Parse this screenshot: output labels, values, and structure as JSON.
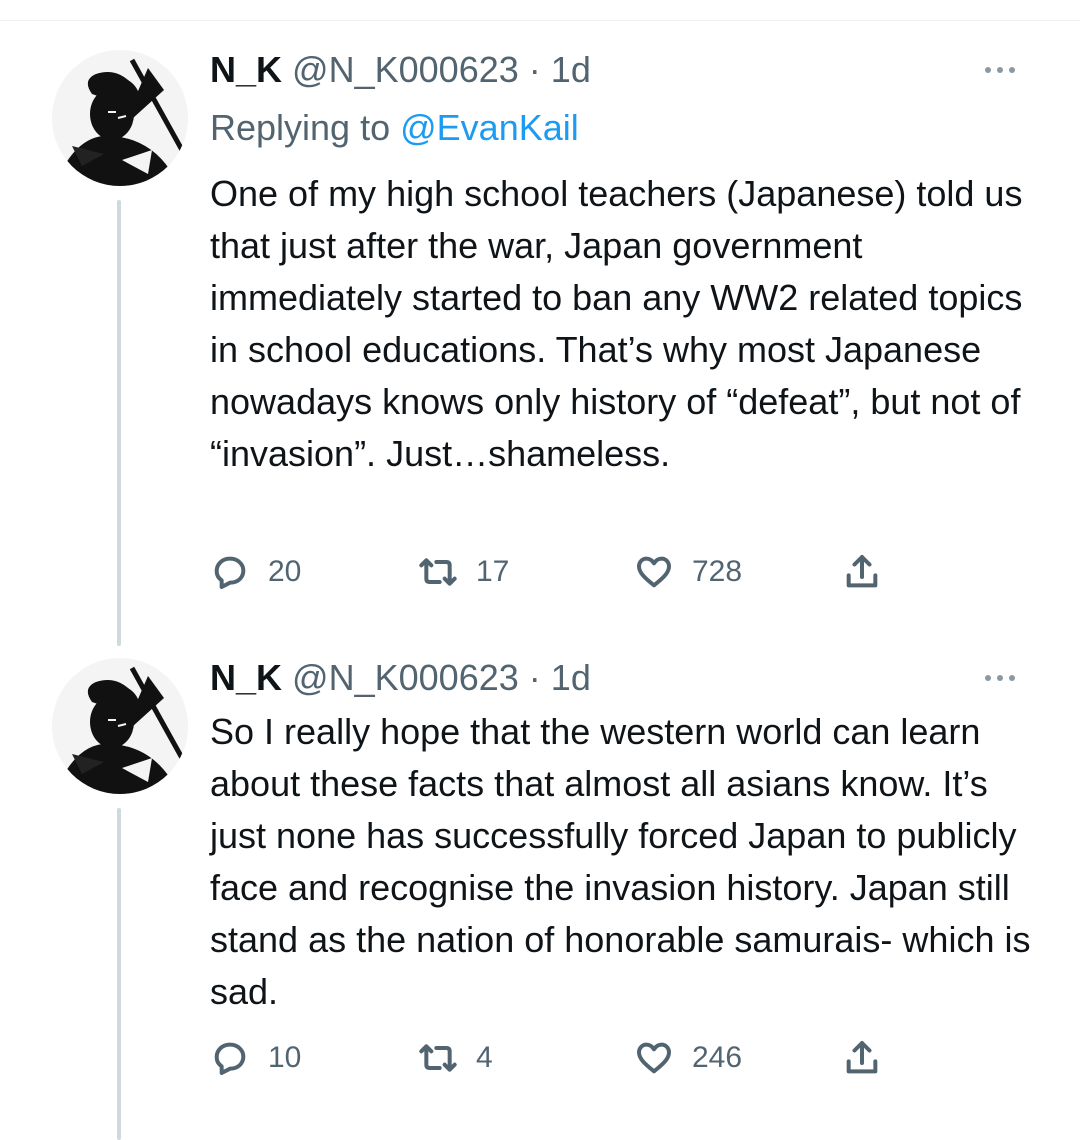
{
  "tweets": [
    {
      "author": {
        "name": "N_K",
        "handle": "@N_K000623",
        "separator": "·",
        "time": "1d"
      },
      "replying_label": "Replying to",
      "replying_mention": "@EvanKail",
      "text": "One of my high school teachers (Japanese) told us that just after the war, Japan government immediately started to ban any WW2 related topics in school educations. That’s why most Japanese nowadays knows only history of “defeat”, but not of “invasion”. Just…shameless.",
      "stats": {
        "replies": "20",
        "retweets": "17",
        "likes": "728"
      },
      "avatar_icon": "samurai-avatar"
    },
    {
      "author": {
        "name": "N_K",
        "handle": "@N_K000623",
        "separator": "·",
        "time": "1d"
      },
      "text": "So I really hope that the western world can learn about these facts that almost all asians know. It’s just none has successfully forced Japan to publicly face and recognise the invasion history. Japan still stand as the nation of honorable samurais- which is sad.",
      "stats": {
        "replies": "10",
        "retweets": "4",
        "likes": "246"
      },
      "avatar_icon": "samurai-avatar"
    }
  ],
  "icons": {
    "reply": "reply-icon",
    "retweet": "retweet-icon",
    "like": "heart-icon",
    "share": "share-icon",
    "more": "more-options-icon"
  },
  "colors": {
    "text": "#0f1419",
    "secondary": "#536471",
    "link": "#1d9bf0",
    "thread_line": "#cfd9de"
  }
}
